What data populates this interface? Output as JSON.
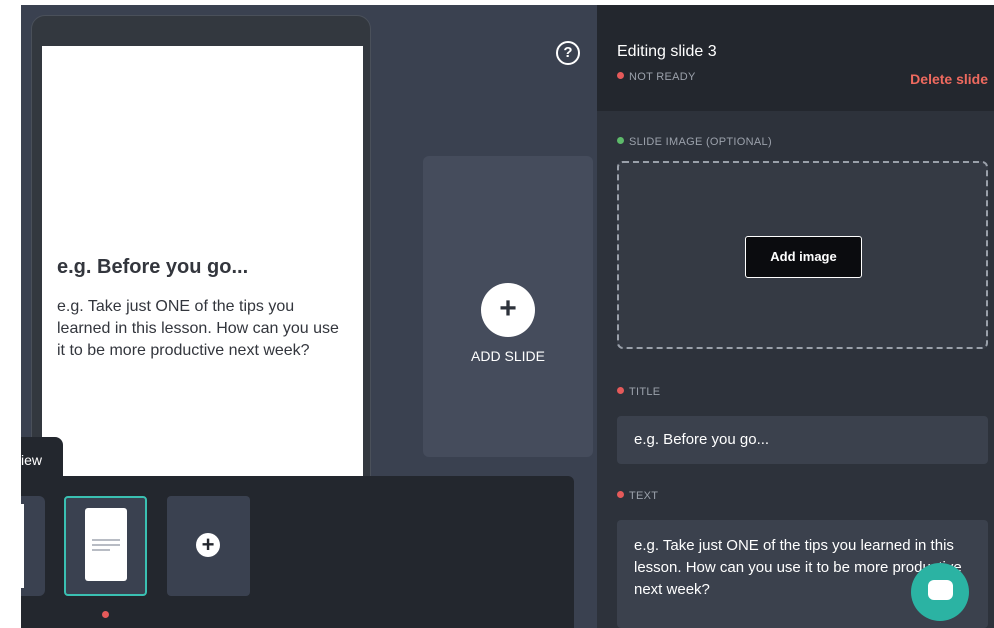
{
  "preview": {
    "slide_title": "e.g. Before you go...",
    "slide_text": "e.g. Take just ONE of the tips you learned in this lesson. How can you use it to be more productive next week?"
  },
  "help_icon": "?",
  "add_slide": {
    "label": "ADD SLIDE",
    "icon": "+"
  },
  "preview_tab": {
    "label": "iew"
  },
  "thumbnails": {
    "add_icon": "+"
  },
  "editor": {
    "heading": "Editing slide 3",
    "status": "NOT READY",
    "delete_label": "Delete slide",
    "image_section_label": "SLIDE IMAGE (OPTIONAL)",
    "add_image_label": "Add image",
    "title_label": "TITLE",
    "title_value": "e.g. Before you go...",
    "text_label": "TEXT",
    "text_value": "e.g. Take just ONE of the tips you learned in this lesson. How can you use it to be more productive next week?"
  },
  "colors": {
    "status_not_ready": "#e55a5a",
    "status_ready": "#5dba6a",
    "delete": "#ef6a5f",
    "active_thumb_border": "#3ac0b2",
    "chat_bubble": "#2bb3a3"
  }
}
